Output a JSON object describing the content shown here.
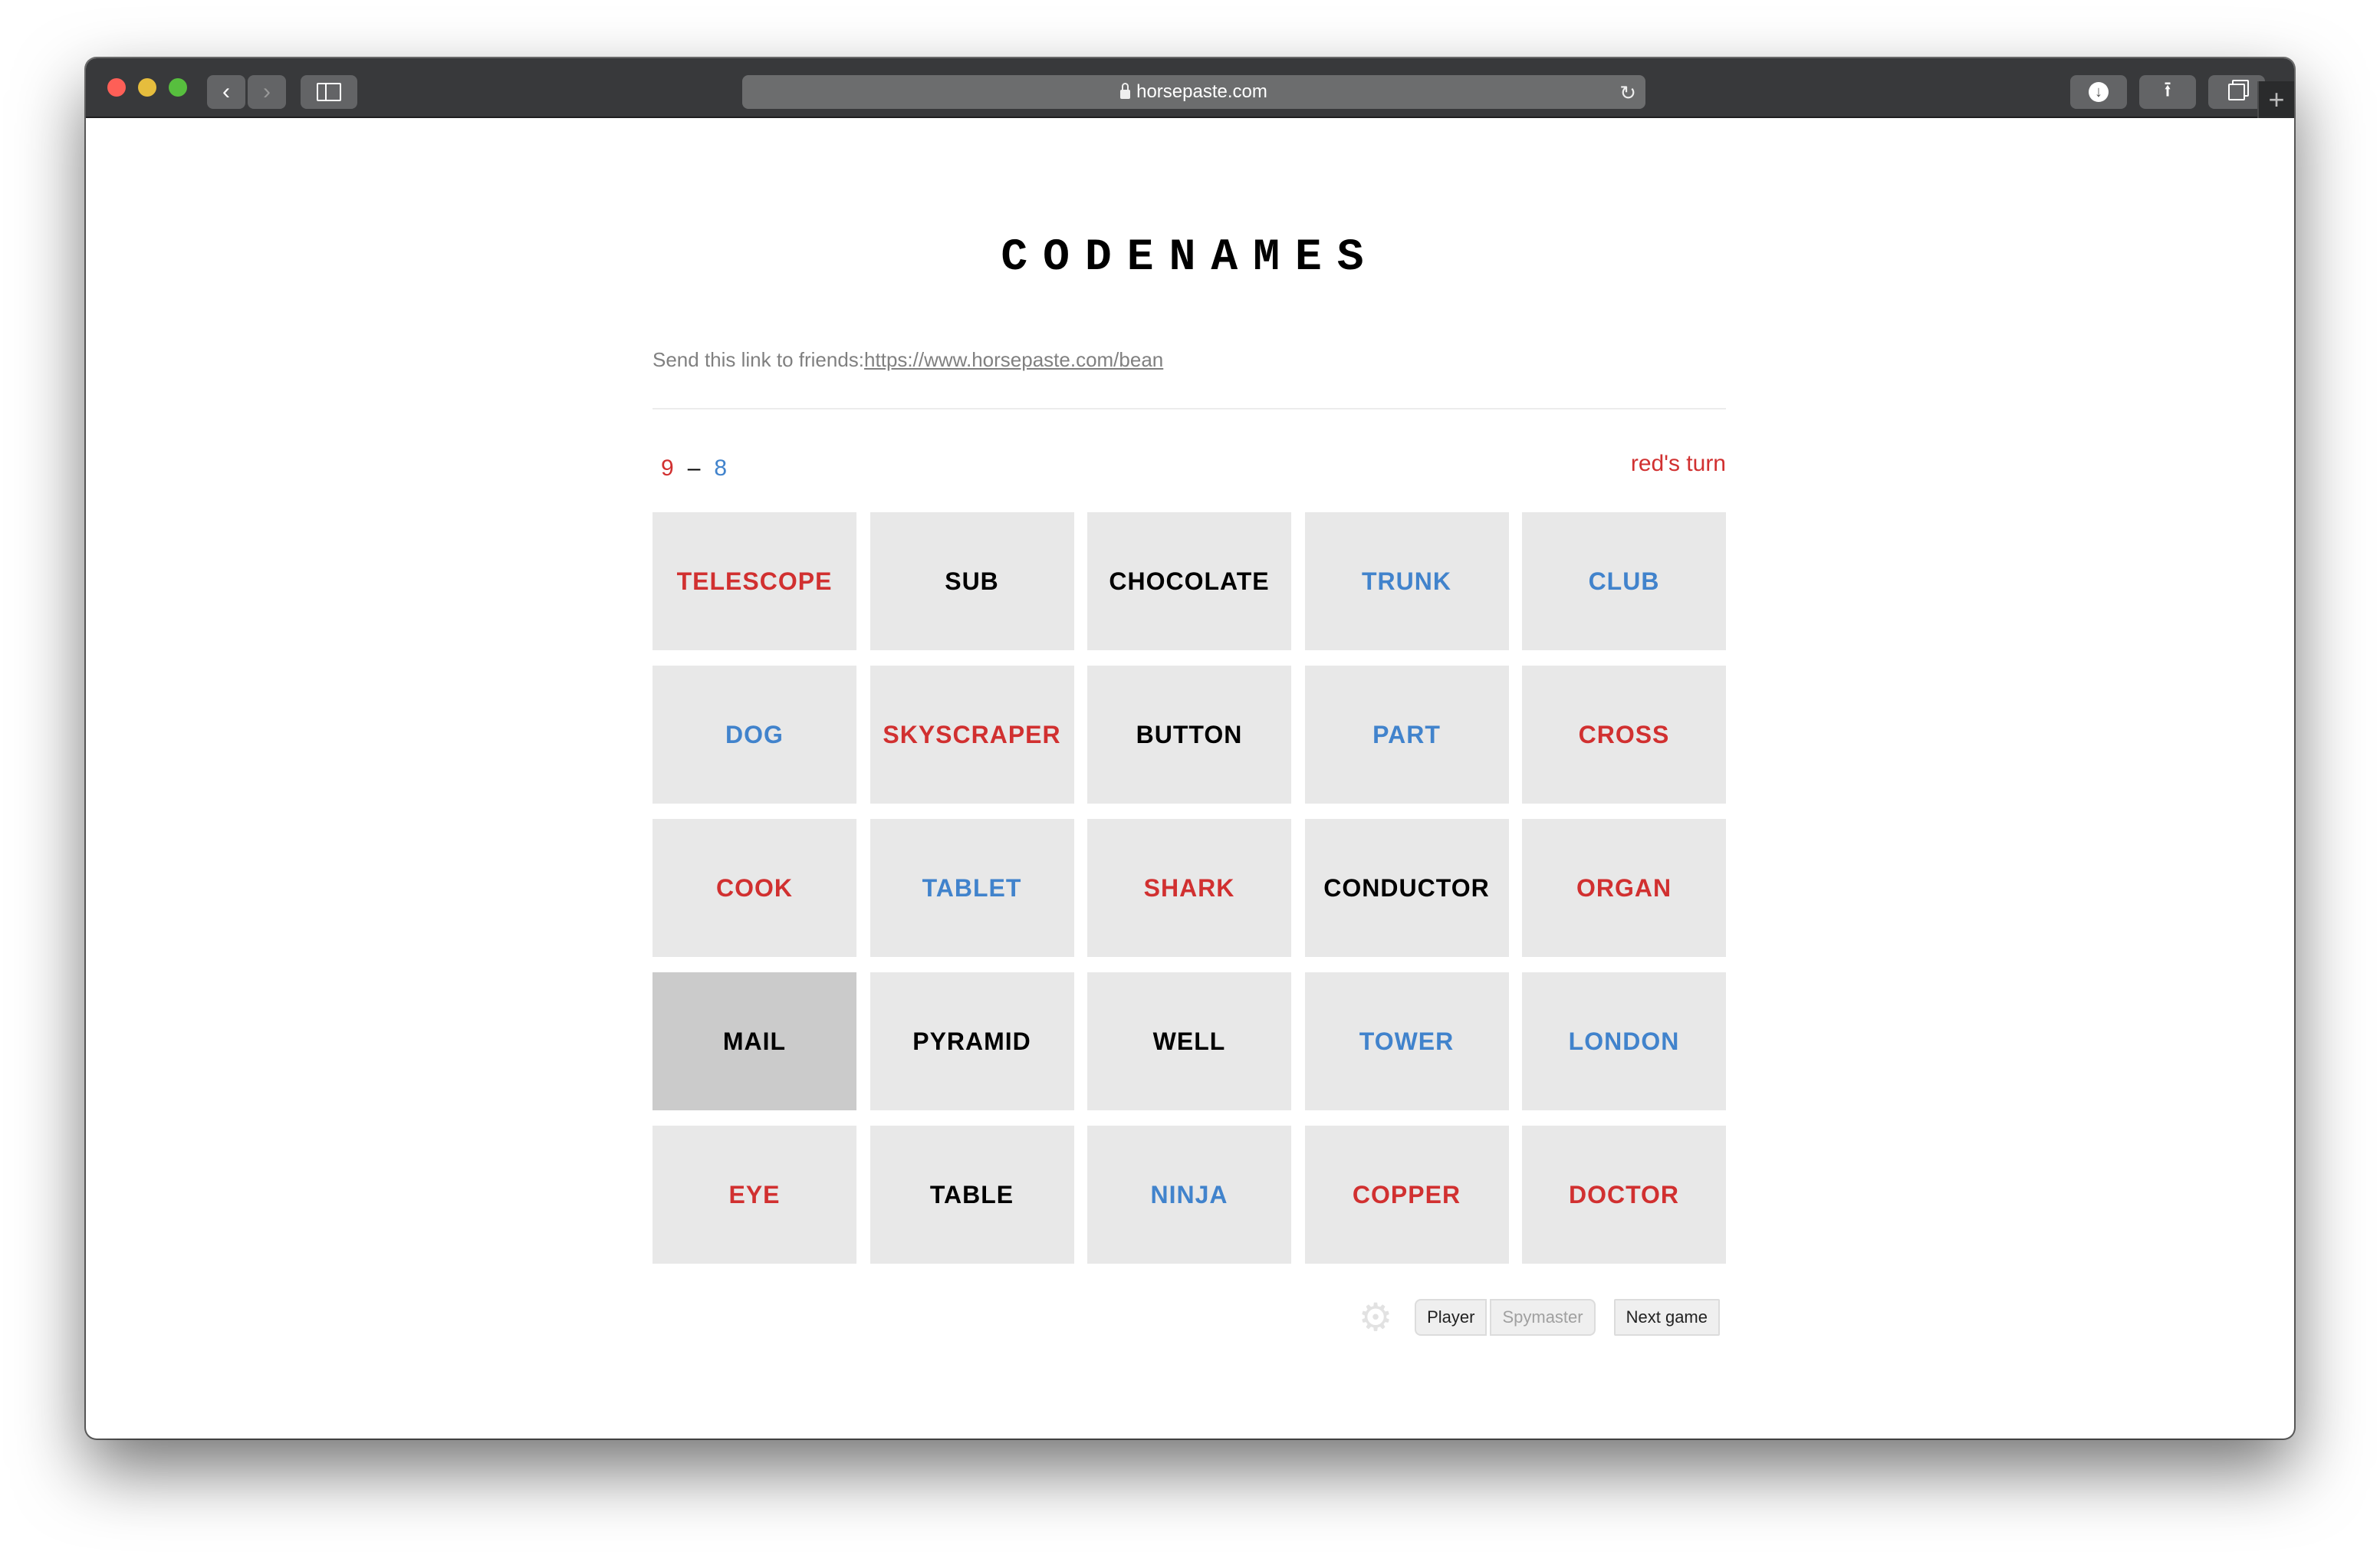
{
  "browser": {
    "url": "horsepaste.com",
    "icons": {
      "back": "chevron-left-icon",
      "forward": "chevron-right-icon",
      "sidebar": "sidebar-icon",
      "lock": "lock-icon",
      "reload": "reload-icon",
      "download": "download-icon",
      "share": "share-icon",
      "tabs": "tabs-icon",
      "new_tab": "plus-icon"
    }
  },
  "page": {
    "title": "CODENAMES",
    "share_prefix": "Send this link to friends:",
    "share_link": "https://www.horsepaste.com/bean",
    "score": {
      "red": "9",
      "separator": "–",
      "blue": "8"
    },
    "turn": "red's turn"
  },
  "colors": {
    "red": "#d13030",
    "blue": "#4183cc",
    "neutral": "#000000",
    "card_bg": "#e8e8e8",
    "revealed_bg": "#cbcbcb"
  },
  "board": [
    {
      "word": "TELESCOPE",
      "team": "red",
      "revealed": false
    },
    {
      "word": "SUB",
      "team": "neutral",
      "revealed": false
    },
    {
      "word": "CHOCOLATE",
      "team": "neutral",
      "revealed": false
    },
    {
      "word": "TRUNK",
      "team": "blue",
      "revealed": false
    },
    {
      "word": "CLUB",
      "team": "blue",
      "revealed": false
    },
    {
      "word": "DOG",
      "team": "blue",
      "revealed": false
    },
    {
      "word": "SKYSCRAPER",
      "team": "red",
      "revealed": false
    },
    {
      "word": "BUTTON",
      "team": "neutral",
      "revealed": false
    },
    {
      "word": "PART",
      "team": "blue",
      "revealed": false
    },
    {
      "word": "CROSS",
      "team": "red",
      "revealed": false
    },
    {
      "word": "COOK",
      "team": "red",
      "revealed": false
    },
    {
      "word": "TABLET",
      "team": "blue",
      "revealed": false
    },
    {
      "word": "SHARK",
      "team": "red",
      "revealed": false
    },
    {
      "word": "CONDUCTOR",
      "team": "neutral",
      "revealed": false
    },
    {
      "word": "ORGAN",
      "team": "red",
      "revealed": false
    },
    {
      "word": "MAIL",
      "team": "neutral",
      "revealed": true
    },
    {
      "word": "PYRAMID",
      "team": "neutral",
      "revealed": false
    },
    {
      "word": "WELL",
      "team": "neutral",
      "revealed": false
    },
    {
      "word": "TOWER",
      "team": "blue",
      "revealed": false
    },
    {
      "word": "LONDON",
      "team": "blue",
      "revealed": false
    },
    {
      "word": "EYE",
      "team": "red",
      "revealed": false
    },
    {
      "word": "TABLE",
      "team": "neutral",
      "revealed": false
    },
    {
      "word": "NINJA",
      "team": "blue",
      "revealed": false
    },
    {
      "word": "COPPER",
      "team": "red",
      "revealed": false
    },
    {
      "word": "DOCTOR",
      "team": "red",
      "revealed": false
    }
  ],
  "footer": {
    "settings_icon": "gear-icon",
    "player_label": "Player",
    "spymaster_label": "Spymaster",
    "next_game_label": "Next game"
  }
}
